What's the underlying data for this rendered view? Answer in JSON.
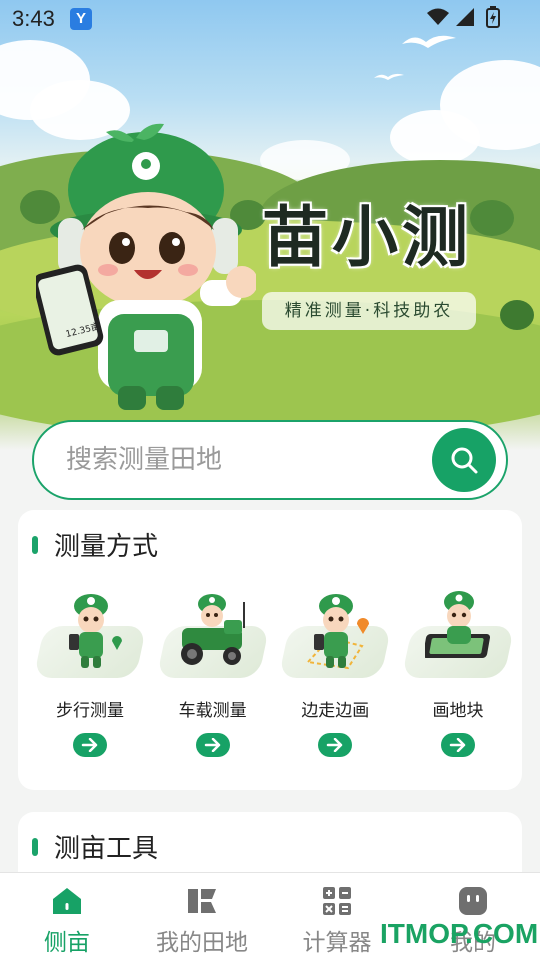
{
  "status_bar": {
    "time": "3:43",
    "app_icon_glyph": "Y"
  },
  "hero": {
    "title": "苗小测",
    "slogan": "精准测量·科技助农",
    "phone_area": "12.35亩"
  },
  "search": {
    "placeholder": "搜索测量田地"
  },
  "measure_section": {
    "title": "测量方式",
    "methods": [
      {
        "label": "步行测量",
        "icon": "walking-mascot-icon"
      },
      {
        "label": "车载测量",
        "icon": "tractor-mascot-icon"
      },
      {
        "label": "边走边画",
        "icon": "draw-while-walking-mascot-icon"
      },
      {
        "label": "画地块",
        "icon": "draw-plot-mascot-icon"
      }
    ]
  },
  "tools_section": {
    "title": "测亩工具"
  },
  "bottom_nav": [
    {
      "label": "侧亩",
      "icon": "home-icon",
      "active": true
    },
    {
      "label": "我的田地",
      "icon": "fields-icon",
      "active": false
    },
    {
      "label": "计算器",
      "icon": "calculator-icon",
      "active": false
    },
    {
      "label": "我的",
      "icon": "profile-icon",
      "active": false
    }
  ],
  "watermark": "ITMOP.COM",
  "colors": {
    "brand_green": "#17a266",
    "text_dark": "#222222",
    "nav_inactive": "#888888"
  }
}
